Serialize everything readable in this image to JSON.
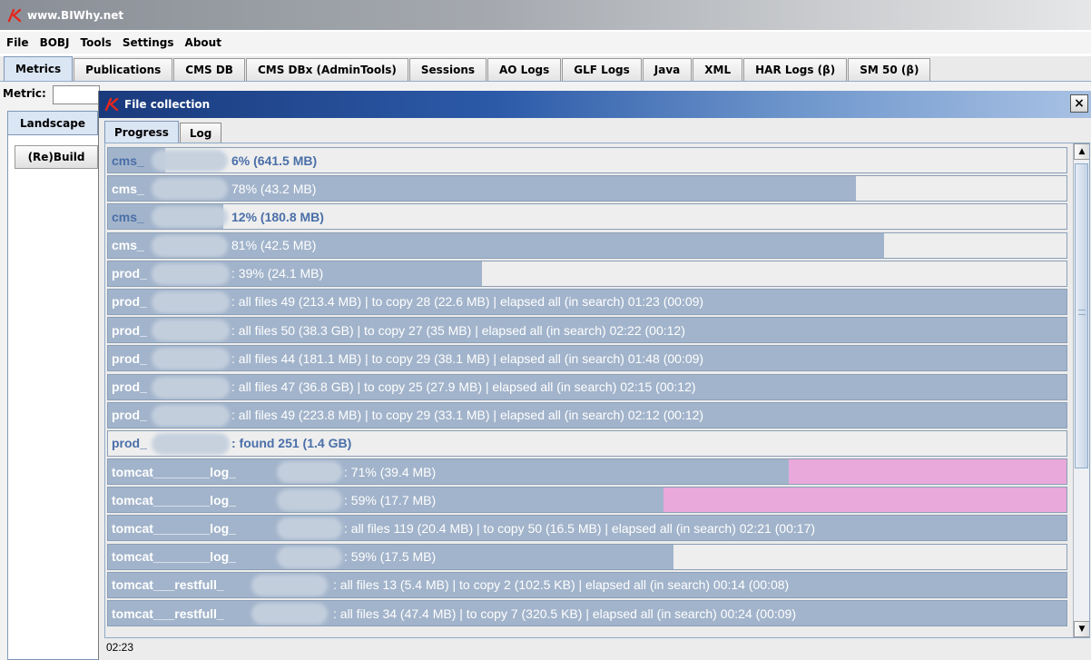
{
  "window": {
    "title": "www.BIWhy.net"
  },
  "menu": [
    "File",
    "BOBJ",
    "Tools",
    "Settings",
    "About"
  ],
  "main_tabs": [
    "Metrics",
    "Publications",
    "CMS DB",
    "CMS DBx (AdminTools)",
    "Sessions",
    "AO Logs",
    "GLF Logs",
    "Java",
    "XML",
    "HAR Logs (β)",
    "SM 50 (β)"
  ],
  "metric_label": "Metric:",
  "sub_tab": "Landscape",
  "rebuild_button": "(Re)Build",
  "dialog": {
    "title": "File collection",
    "close_label": "×",
    "tabs": [
      "Progress",
      "Log"
    ],
    "status_time": "02:23"
  },
  "rows": [
    {
      "name": "cms_",
      "text": "6% (641.5 MB)",
      "progress": 0.06,
      "style": "blue"
    },
    {
      "name": "cms_",
      "text": "78% (43.2 MB)",
      "progress": 0.78,
      "style": "light"
    },
    {
      "name": "cms_",
      "text": "12% (180.8 MB)",
      "progress": 0.12,
      "style": "blue"
    },
    {
      "name": "cms_",
      "text": "81% (42.5 MB)",
      "progress": 0.81,
      "style": "light"
    },
    {
      "name": "prod_",
      "text": ": 39% (24.1 MB)",
      "progress": 0.39,
      "style": "light"
    },
    {
      "name": "prod_",
      "text": ": all files 49 (213.4 MB) | to copy 28 (22.6 MB) | elapsed all (in search) 01:23 (00:09)",
      "progress": 1.0,
      "style": "light"
    },
    {
      "name": "prod_",
      "text": ": all files 50 (38.3 GB) | to copy 27 (35 MB) | elapsed all (in search) 02:22 (00:12)",
      "progress": 1.0,
      "style": "light"
    },
    {
      "name": "prod_",
      "text": ": all files 44 (181.1 MB) | to copy 29 (38.1 MB) | elapsed all (in search) 01:48 (00:09)",
      "progress": 1.0,
      "style": "light"
    },
    {
      "name": "prod_",
      "text": ": all files 47 (36.8 GB) | to copy 25 (27.9 MB) | elapsed all (in search) 02:15 (00:12)",
      "progress": 1.0,
      "style": "light"
    },
    {
      "name": "prod_",
      "text": ": all files 49 (223.8 MB) | to copy 29 (33.1 MB) | elapsed all (in search) 02:12 (00:12)",
      "progress": 1.0,
      "style": "light"
    },
    {
      "name": "prod_",
      "text": ": found 251 (1.4 GB)",
      "progress": 0.0,
      "style": "blue"
    },
    {
      "name": "tomcat________log_",
      "text": ": 71% (39.4 MB)",
      "progress": 0.71,
      "style": "light",
      "extra": 0.29,
      "extra_color": "#e9a9da"
    },
    {
      "name": "tomcat________log_",
      "text": ": 59% (17.7 MB)",
      "progress": 0.58,
      "style": "light",
      "extra": 0.42,
      "extra_color": "#e9a9da"
    },
    {
      "name": "tomcat________log_",
      "text": ": all files 119 (20.4 MB) | to copy 50 (16.5 MB) | elapsed all (in search) 02:21 (00:17)",
      "progress": 1.0,
      "style": "light"
    },
    {
      "name": "tomcat________log_",
      "text": ": 59% (17.5 MB)",
      "progress": 0.59,
      "style": "light"
    },
    {
      "name": "tomcat___restfull_",
      "text": ": all files 13 (5.4 MB) | to copy 2 (102.5 KB) | elapsed all (in search) 00:14 (00:08)",
      "progress": 1.0,
      "style": "light"
    },
    {
      "name": "tomcat___restfull_",
      "text": ": all files 34 (47.4 MB) | to copy 7 (320.5 KB) | elapsed all (in search) 00:24 (00:09)",
      "progress": 1.0,
      "style": "light"
    }
  ],
  "colors": {
    "progress_fill": "#a2b4cb",
    "extra_fill": "#e9a9da",
    "highlight_text": "#4a6fa8"
  }
}
